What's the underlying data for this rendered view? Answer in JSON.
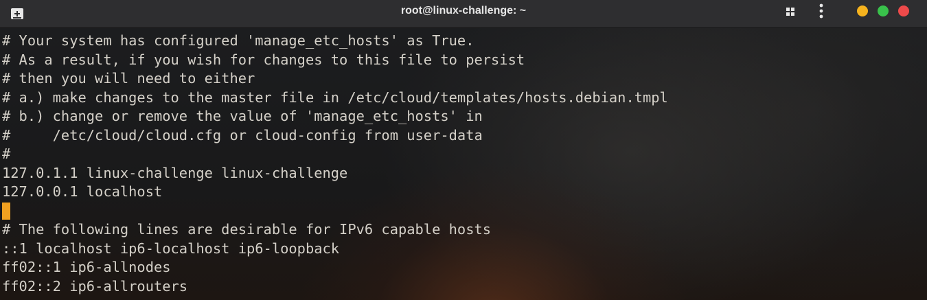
{
  "window": {
    "title": "root@linux-challenge: ~",
    "buttons": {
      "minimize_color": "#f6b31e",
      "maximize_color": "#39c24b",
      "close_color": "#ee4a4a"
    },
    "icons": {
      "new_tab": "new-tab-icon",
      "view": "grid-view-icon",
      "menu": "kebab-menu-icon"
    }
  },
  "terminal": {
    "lines": [
      "# Your system has configured 'manage_etc_hosts' as True.",
      "# As a result, if you wish for changes to this file to persist",
      "# then you will need to either",
      "# a.) make changes to the master file in /etc/cloud/templates/hosts.debian.tmpl",
      "# b.) change or remove the value of 'manage_etc_hosts' in",
      "#     /etc/cloud/cloud.cfg or cloud-config from user-data",
      "#",
      "127.0.1.1 linux-challenge linux-challenge",
      "127.0.0.1 localhost",
      "",
      "# The following lines are desirable for IPv6 capable hosts",
      "::1 localhost ip6-localhost ip6-loopback",
      "ff02::1 ip6-allnodes",
      "ff02::2 ip6-allrouters"
    ],
    "cursor_color": "#f0a020"
  }
}
